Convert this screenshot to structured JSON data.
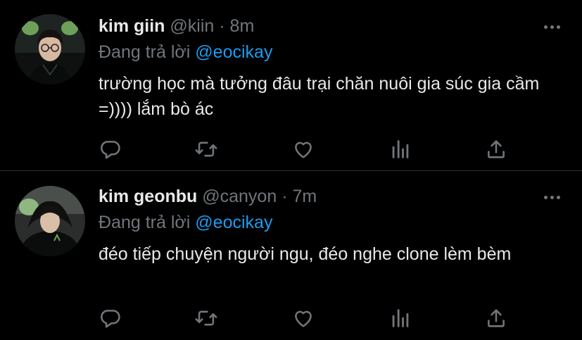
{
  "tweets": [
    {
      "name": "kim giin",
      "handle": "@kiin",
      "separator": "·",
      "time": "8m",
      "reply_prefix": "Đang trả lời",
      "reply_to": "@eocikay",
      "text": "trường học mà tưởng đâu trại chăn nuôi gia súc gia cầm =)))) lắm bò ác",
      "actions": [
        "reply-icon",
        "retweet-icon",
        "like-icon",
        "analytics-icon",
        "share-icon"
      ]
    },
    {
      "name": "kim geonbu",
      "handle": "@canyon",
      "separator": "·",
      "time": "7m",
      "reply_prefix": "Đang trả lời",
      "reply_to": "@eocikay",
      "text": "đéo tiếp chuyện người ngu, đéo nghe clone lèm bèm",
      "actions": [
        "reply-icon",
        "retweet-icon",
        "like-icon",
        "analytics-icon",
        "share-icon"
      ]
    }
  ],
  "colors": {
    "background": "#000000",
    "text": "#e7e9ea",
    "secondary": "#71767b",
    "accent": "#1d9bf0",
    "divider": "#2f3336"
  }
}
